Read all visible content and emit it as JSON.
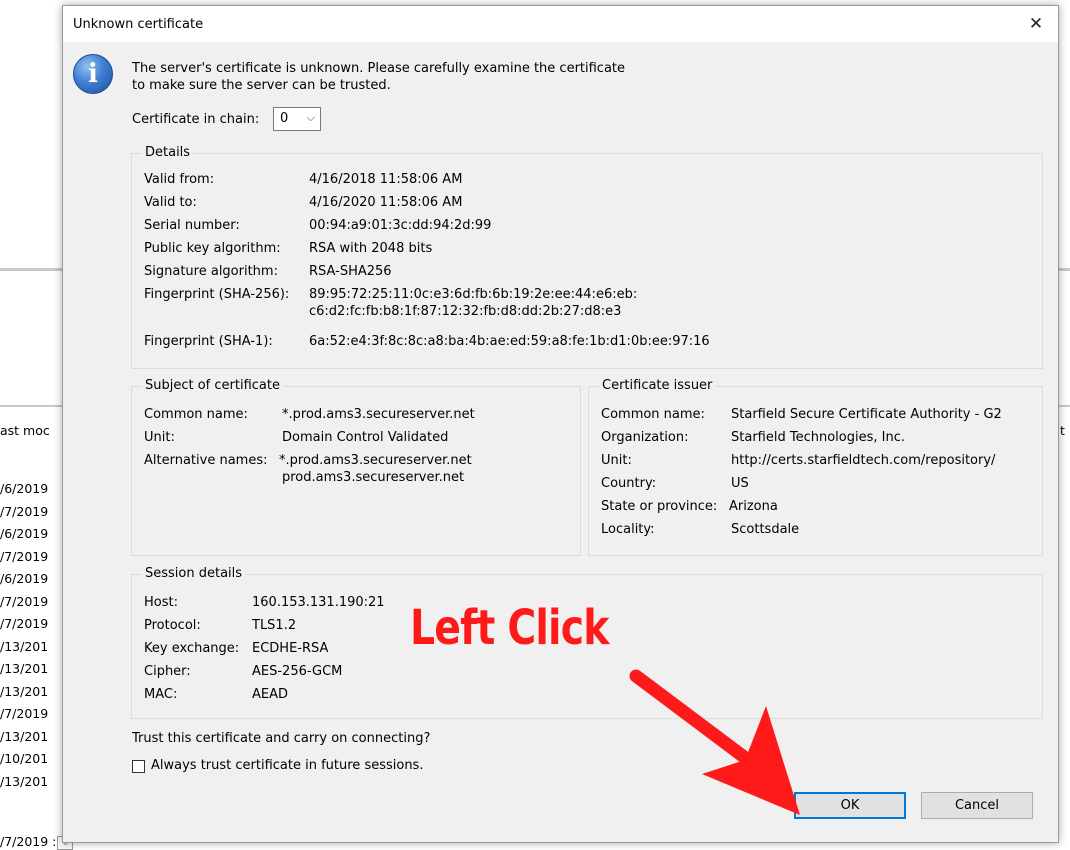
{
  "background": {
    "column_header_left": "ast moc",
    "column_header_right": "t m",
    "dates": [
      "/6/2019",
      "/7/2019",
      "/6/2019",
      "/7/2019",
      "/6/2019",
      "/7/2019",
      "/7/2019",
      "/13/201",
      "/13/201",
      "/13/201",
      "/7/2019",
      "/13/201",
      "/10/201",
      "/13/201"
    ],
    "last_cell": "/7/2019 :"
  },
  "dialog": {
    "title": "Unknown certificate",
    "message_line1": "The server's certificate is unknown. Please carefully examine the certificate",
    "message_line2": "to make sure the server can be trusted.",
    "chain_label": "Certificate in chain:",
    "chain_value": "0",
    "details": {
      "title": "Details",
      "valid_from_label": "Valid from:",
      "valid_from": "4/16/2018 11:58:06 AM",
      "valid_to_label": "Valid to:",
      "valid_to": "4/16/2020 11:58:06 AM",
      "serial_label": "Serial number:",
      "serial": "00:94:a9:01:3c:dd:94:2d:99",
      "pubkey_label": "Public key algorithm:",
      "pubkey": "RSA with 2048 bits",
      "sigalg_label": "Signature algorithm:",
      "sigalg": "RSA-SHA256",
      "fp256_label": "Fingerprint (SHA-256):",
      "fp256_line1": "89:95:72:25:11:0c:e3:6d:fb:6b:19:2e:ee:44:e6:eb:",
      "fp256_line2": "c6:d2:fc:fb:b8:1f:87:12:32:fb:d8:dd:2b:27:d8:e3",
      "fp1_label": "Fingerprint (SHA-1):",
      "fp1": "6a:52:e4:3f:8c:8c:a8:ba:4b:ae:ed:59:a8:fe:1b:d1:0b:ee:97:16"
    },
    "subject": {
      "title": "Subject of certificate",
      "cn_label": "Common name:",
      "cn": "*.prod.ams3.secureserver.net",
      "unit_label": "Unit:",
      "unit": "Domain Control Validated",
      "alt_label": "Alternative names:",
      "alt_line1": "*.prod.ams3.secureserver.net",
      "alt_line2": "prod.ams3.secureserver.net"
    },
    "issuer": {
      "title": "Certificate issuer",
      "cn_label": "Common name:",
      "cn": "Starfield Secure Certificate Authority - G2",
      "org_label": "Organization:",
      "org": "Starfield Technologies, Inc.",
      "unit_label": "Unit:",
      "unit": "http://certs.starfieldtech.com/repository/",
      "country_label": "Country:",
      "country": "US",
      "state_label": "State or province:",
      "state": "Arizona",
      "locality_label": "Locality:",
      "locality": "Scottsdale"
    },
    "session": {
      "title": "Session details",
      "host_label": "Host:",
      "host": "160.153.131.190:21",
      "protocol_label": "Protocol:",
      "protocol": "TLS1.2",
      "kex_label": "Key exchange:",
      "kex": "ECDHE-RSA",
      "cipher_label": "Cipher:",
      "cipher": "AES-256-GCM",
      "mac_label": "MAC:",
      "mac": "AEAD"
    },
    "trust_question": "Trust this certificate and carry on connecting?",
    "always_trust_label": "Always trust certificate in future sessions.",
    "always_trust_checked": false,
    "ok_label": "OK",
    "cancel_label": "Cancel",
    "close_glyph": "✕",
    "info_glyph": "i",
    "select_arrow_glyph": "⌵"
  },
  "annotation": {
    "text": "Left Click",
    "color": "#ff1a1a"
  },
  "icons": [
    "info-icon",
    "close-icon",
    "chevron-down-icon",
    "red-arrow-icon"
  ]
}
